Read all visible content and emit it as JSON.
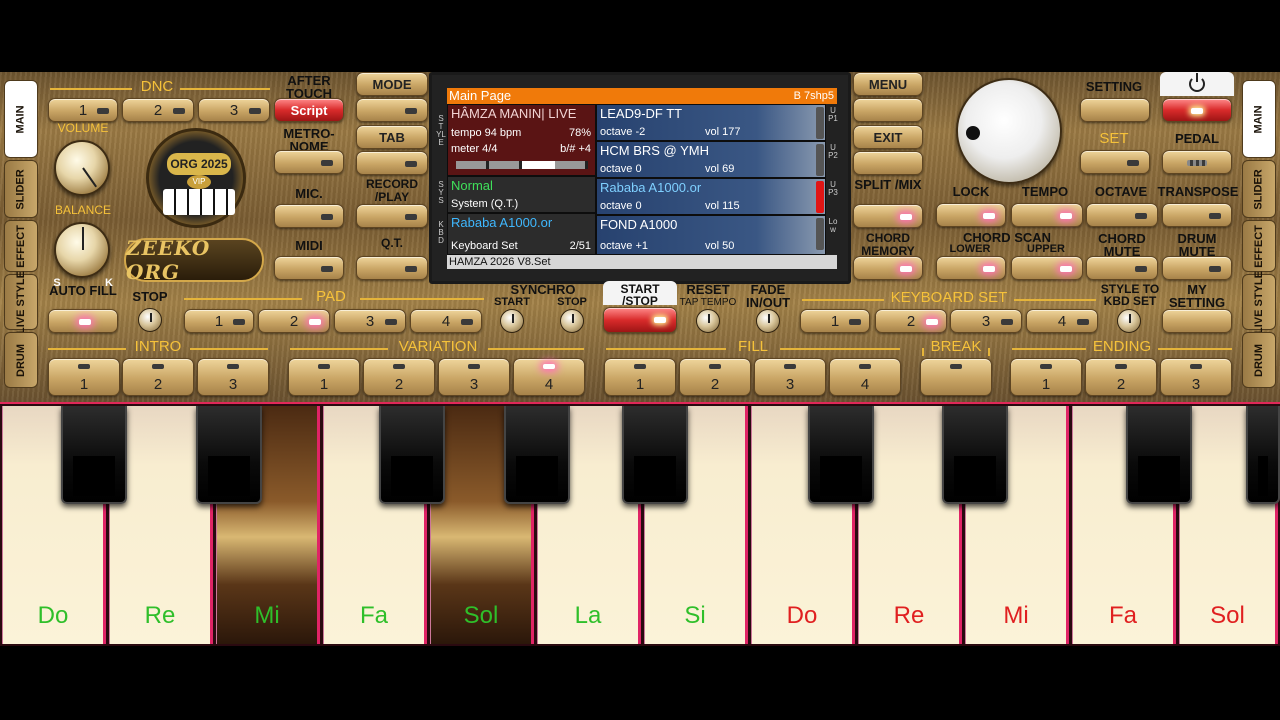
{
  "side_tabs_left": [
    "MAIN",
    "SLIDER",
    "EFFECT",
    "LIVE STYLE",
    "DRUM"
  ],
  "side_tabs_right": [
    "MAIN",
    "SLIDER",
    "EFFECT",
    "LIVE STYLE",
    "DRUM"
  ],
  "dnc": {
    "label": "DNC",
    "buttons": [
      "1",
      "2",
      "3"
    ],
    "script_label": "Script"
  },
  "after_touch_label": "AFTER TOUCH",
  "metronome_label": "METRO- NOME",
  "mic_label": "MIC.",
  "midi_label": "MIDI",
  "volume_label": "VOLUME",
  "balance_label": "BALANCE",
  "balance_s": "S",
  "balance_k": "K",
  "logo_text": "ZEEKO ORG",
  "badge": {
    "title": "ORG 2025",
    "sub": "VIP"
  },
  "mode_label": "MODE",
  "tab_label": "TAB",
  "record_label": "RECORD /PLAY",
  "qt_label": "Q.T.",
  "screen": {
    "header": "Main Page",
    "header_right": "B 7shp5",
    "style_name": "HÂMZA MANIN| LIVE",
    "tempo": "tempo 94 bpm",
    "tempo_pct": "78%",
    "meter": "meter 4/4",
    "transpose": "b/# +4",
    "sys_name": "Normal",
    "sys_sub": "System (Q.T.)",
    "kbd_name": "Rababa A1000.or",
    "kbd_sub": "Keyboard Set",
    "kbd_count": "2/51",
    "parts": [
      {
        "name": "LEAD9-DF TT",
        "octave": "octave -2",
        "vol": "vol 177"
      },
      {
        "name": "HCM BRS @ YMH",
        "octave": "octave  0",
        "vol": "vol 69"
      },
      {
        "name": "Rababa A1000.or",
        "octave": "octave  0",
        "vol": "vol 115"
      },
      {
        "name": "FOND A1000",
        "octave": "octave +1",
        "vol": "vol 50"
      }
    ],
    "left_labels": [
      "STYLE",
      "SYS",
      "KBD"
    ],
    "right_labels": [
      "UP1",
      "UP2",
      "UP3",
      "Low"
    ],
    "footer": "HAMZA 2026 V8.Set"
  },
  "menu_label": "MENU",
  "exit_label": "EXIT",
  "split_label": "SPLIT /MIX",
  "chord_memory_label": "CHORD MEMORY",
  "setting_label": "SETTING",
  "set_label": "SET",
  "pedal_label": "PEDAL",
  "lock_label": "LOCK",
  "tempo_label": "TEMPO",
  "octave_label": "OCTAVE",
  "transpose_label": "TRANSPOSE",
  "chord_scan_label": "CHORD SCAN",
  "lower_label": "LOWER",
  "upper_label": "UPPER",
  "chord_mute_label": "CHORD MUTE",
  "drum_mute_label": "DRUM MUTE",
  "auto_fill_label": "AUTO FILL",
  "stop_label": "STOP",
  "pad": {
    "label": "PAD",
    "buttons": [
      "1",
      "2",
      "3",
      "4"
    ]
  },
  "synchro": {
    "label": "SYNCHRO",
    "start": "START",
    "stop": "STOP"
  },
  "start_stop_label": "START /STOP",
  "reset_label": "RESET",
  "tap_tempo_label": "TAP TEMPO",
  "fade_label": "FADE IN/OUT",
  "keyboard_set": {
    "label": "KEYBOARD SET",
    "buttons": [
      "1",
      "2",
      "3",
      "4"
    ]
  },
  "style_to_kbd_label": "STYLE TO KBD SET",
  "my_setting_label": "MY SETTING",
  "intro": {
    "label": "INTRO",
    "buttons": [
      "1",
      "2",
      "3"
    ]
  },
  "variation": {
    "label": "VARIATION",
    "buttons": [
      "1",
      "2",
      "3",
      "4"
    ]
  },
  "fill": {
    "label": "FILL",
    "buttons": [
      "1",
      "2",
      "3",
      "4"
    ]
  },
  "break_label": "BREAK",
  "ending": {
    "label": "ENDING",
    "buttons": [
      "1",
      "2",
      "3"
    ]
  },
  "keys": [
    "Do",
    "Re",
    "Mi",
    "Fa",
    "Sol",
    "La",
    "Si",
    "Do",
    "Re",
    "Mi",
    "Fa",
    "Sol"
  ],
  "colors": {
    "note_green": "#2fbf2a",
    "note_red": "#e02020",
    "accent_gold": "#f6c23a",
    "screen_header": "#f07a0a",
    "key_border": "#e02466"
  }
}
